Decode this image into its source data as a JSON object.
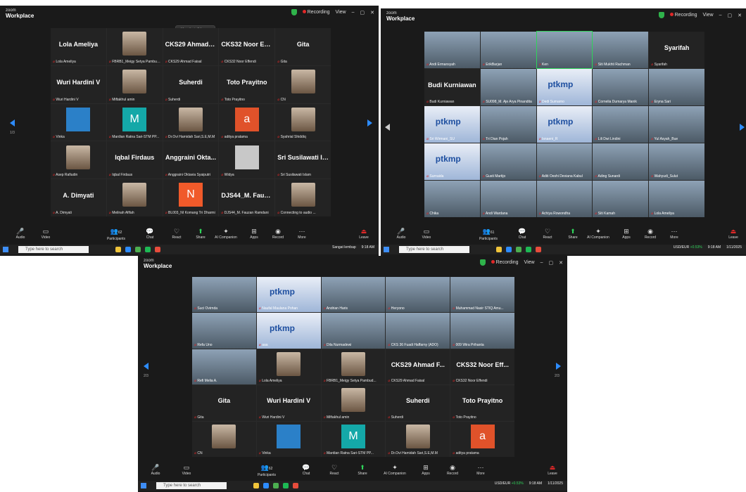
{
  "app": {
    "brand_small": "zoom",
    "brand": "Workplace",
    "recording": "Recording",
    "view": "View"
  },
  "speaking": "Ken is talking...",
  "toolbar": {
    "audio": "Audio",
    "video": "Video",
    "participants": "Participants",
    "chat": "Chat",
    "react": "React",
    "share": "Share",
    "ai": "AI Companion",
    "apps": "Apps",
    "record": "Record",
    "more": "More",
    "leave": "Leave"
  },
  "taskbar": {
    "search": "Type here to search",
    "weather": "Sangat lembap",
    "ticker": "USD/EUR",
    "ticker_change": "+0.53%",
    "time": "9:18 AM",
    "date": "1/11/2025"
  },
  "pages": {
    "s1": "1/3",
    "s3": "2/3"
  },
  "counts": {
    "s1": "62",
    "s2": "61",
    "s3": "62"
  },
  "screen1": [
    {
      "big": "Lola Ameliya",
      "cap": "Lola Ameliya"
    },
    {
      "av": "photo",
      "cap": "FBRB1_Meigy Setya Pambud..."
    },
    {
      "big": "CKS29 Ahmad F...",
      "cap": "CKS29 Ahmad Faisal"
    },
    {
      "big": "CKS32 Noor Eff...",
      "cap": "CKS32 Noor Effendi"
    },
    {
      "big": "Gita",
      "cap": "Gita"
    },
    {
      "big": "Wuri Hardini V",
      "cap": "Wuri Hardini V"
    },
    {
      "av": "photo",
      "cap": "Miftakhul amin"
    },
    {
      "big": "Suherdi",
      "cap": "Suherdi"
    },
    {
      "big": "Toto Prayitno",
      "cap": "Toto Prayitno"
    },
    {
      "av": "photo",
      "cap": "CN"
    },
    {
      "av": "cart",
      "cap": "Vinka"
    },
    {
      "av": "m",
      "letter": "M",
      "cap": "Mardian Ratna Sari-STM PP..."
    },
    {
      "av": "photo",
      "cap": "Dr.Ovi Hamidah Sari,S.E,M.M"
    },
    {
      "av": "a",
      "letter": "a",
      "cap": "aditya pratama"
    },
    {
      "av": "photo",
      "cap": "Syahrial Shiddiq"
    },
    {
      "av": "photo",
      "cap": "Asep Rafiudin"
    },
    {
      "big": "Iqbal Firdaus",
      "cap": "Iqbal Firdaus"
    },
    {
      "big": "Anggraini Okta...",
      "cap": "Anggraini Oktavia Syaiputri"
    },
    {
      "av": "g",
      "cap": "Widya"
    },
    {
      "big": "Sri Susilawati Is...",
      "cap": "Sri Susilawati Islam"
    },
    {
      "big": "A. Dimyati",
      "cap": "A. Dimyati"
    },
    {
      "av": "photo",
      "cap": "Meilnah Afifah"
    },
    {
      "av": "n",
      "letter": "N",
      "cap": "BL003_NI Komang Tri Dharmi"
    },
    {
      "big": "DJS44_M. Fauza...",
      "cap": "DJS44_M. Fauzan Ramdani"
    },
    {
      "av": "photo",
      "cap": "Connecting to audio ..."
    }
  ],
  "screen2": [
    {
      "video": "v",
      "cap": "Andi Ermansyah"
    },
    {
      "video": "v",
      "cap": "ErikBarjan"
    },
    {
      "video": "v",
      "active": true,
      "cap": "Ken"
    },
    {
      "video": "v",
      "cap": "Siti Mukhti Rachman"
    },
    {
      "big": "Syarifah",
      "cap": "Syarifah"
    },
    {
      "big": "Budi Kurniawan",
      "cap": "Budi Kurniawan"
    },
    {
      "video": "v",
      "cap": "SU098_M. Aje Arya Pinandita"
    },
    {
      "video": "ptk",
      "cap": "Dedi Sumarno"
    },
    {
      "video": "v",
      "cap": "Cornelia Dumarya Manik"
    },
    {
      "video": "v",
      "cap": "Eryna Sari"
    },
    {
      "video": "ptk",
      "cap": "Sri Wirmani_SU"
    },
    {
      "video": "v",
      "cap": "Tri Dian Pojah"
    },
    {
      "video": "ptk",
      "cap": "Isnaeni_R"
    },
    {
      "video": "v",
      "cap": "Lili Dwi Lindini"
    },
    {
      "video": "v",
      "cap": "Yul Asyah_Bue"
    },
    {
      "video": "ptk",
      "cap": "Surnaida"
    },
    {
      "video": "v",
      "cap": "Gusti Martijo"
    },
    {
      "video": "v",
      "cap": "Aditi Oeshi Deviana Kabul"
    },
    {
      "video": "v",
      "cap": "Ading Sunardi"
    },
    {
      "video": "v",
      "cap": "Wahyudi_Sulut"
    },
    {
      "video": "v",
      "cap": "Chika"
    },
    {
      "video": "v",
      "cap": "Andi Wardana"
    },
    {
      "video": "v",
      "cap": "Achiya Rowondha"
    },
    {
      "video": "v",
      "cap": "Siti Kamah"
    },
    {
      "video": "v",
      "cap": "Lola Ameliya"
    }
  ],
  "screen3": [
    {
      "video": "v",
      "cap": "Suci Ovirnda"
    },
    {
      "video": "ptk",
      "cap": "Naufal Maulana Pohan"
    },
    {
      "video": "v",
      "cap": "Andrian Haris"
    },
    {
      "video": "v",
      "cap": "Heryono"
    },
    {
      "video": "v",
      "cap": "Muhammad Nasir STIQ Amu..."
    },
    {
      "video": "v",
      "cap": "Refa Uno"
    },
    {
      "video": "ptk",
      "cap": "aaa"
    },
    {
      "video": "v",
      "cap": "Dila Nurmadewi"
    },
    {
      "video": "v",
      "cap": "CKS 36 Fuadi Haffarny (ADO)"
    },
    {
      "video": "v",
      "cap": "009 Wira Prihanta"
    },
    {
      "video": "v",
      "cap": "Refi Melia A."
    },
    {
      "av": "photo",
      "cap": "Lola Ameliya"
    },
    {
      "av": "photo",
      "cap": "FBRB1_Meigy Setya Pambud..."
    },
    {
      "big": "CKS29 Ahmad F...",
      "cap": "CKS29 Ahmad Faisal"
    },
    {
      "big": "CKS32 Noor Eff...",
      "cap": "CKS32 Noor Effendi"
    },
    {
      "big": "Gita",
      "cap": "Gita"
    },
    {
      "big": "Wuri Hardini V",
      "cap": "Wuri Hardini V"
    },
    {
      "av": "photo",
      "cap": "Miftakhul amin"
    },
    {
      "big": "Suherdi",
      "cap": "Suherdi"
    },
    {
      "big": "Toto Prayitno",
      "cap": "Toto Prayitno"
    },
    {
      "av": "photo",
      "cap": "CN"
    },
    {
      "av": "cart",
      "cap": "Vinka"
    },
    {
      "av": "m",
      "letter": "M",
      "cap": "Mardian Ratna Sari-STM PP..."
    },
    {
      "av": "photo",
      "cap": "Dr.Ovi Hamidah Sari,S.E,M.M"
    },
    {
      "av": "a",
      "letter": "a",
      "cap": "aditya pratama"
    }
  ]
}
